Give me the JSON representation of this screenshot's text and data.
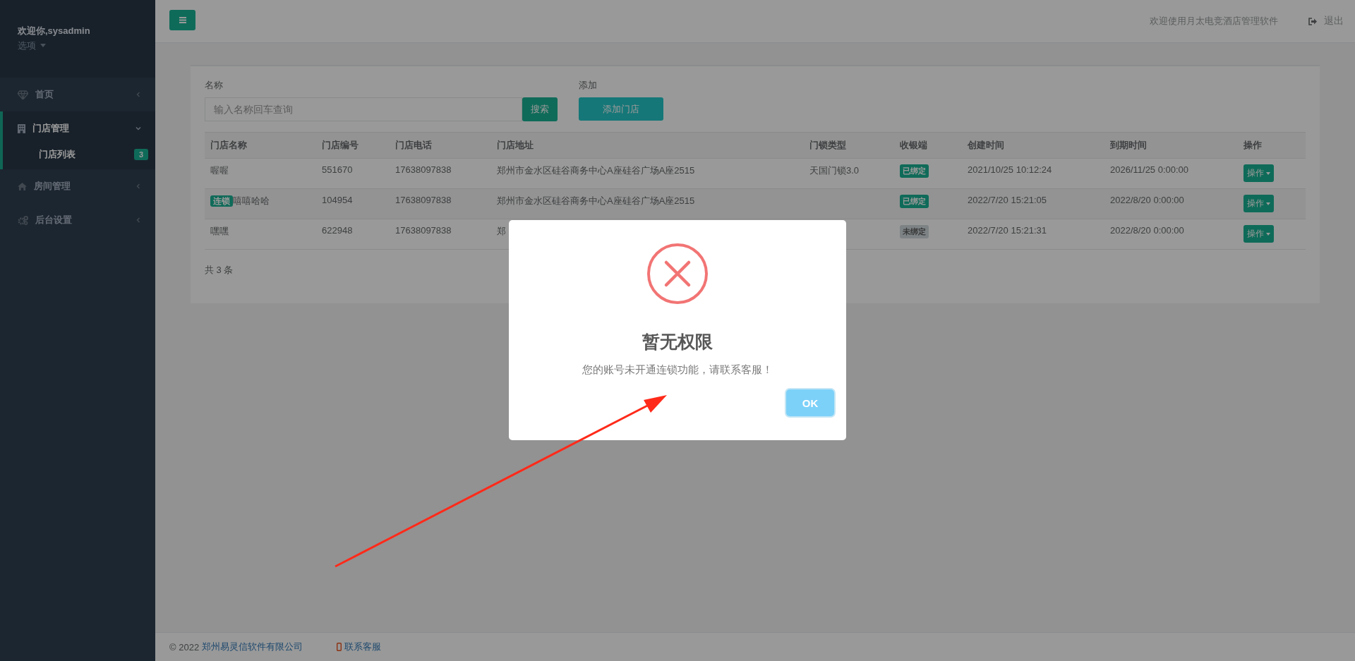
{
  "sidebar": {
    "user": "欢迎你,sysadmin",
    "options": "选项",
    "items": [
      {
        "label": "首页",
        "selected": false,
        "expanded": false
      },
      {
        "label": "门店管理",
        "selected": true,
        "expanded": true,
        "children": [
          {
            "label": "门店列表",
            "badge": "3",
            "selected": true
          }
        ]
      },
      {
        "label": "房间管理",
        "selected": false,
        "expanded": false
      },
      {
        "label": "后台设置",
        "selected": false,
        "expanded": false
      }
    ]
  },
  "header": {
    "welcome": "欢迎使用月太电竞酒店管理软件",
    "logout": "退出"
  },
  "search": {
    "label": "名称",
    "placeholder": "输入名称回车查询",
    "button": "搜索"
  },
  "add": {
    "label": "添加",
    "button": "添加门店"
  },
  "table": {
    "columns": [
      "门店名称",
      "门店编号",
      "门店电话",
      "门店地址",
      "门锁类型",
      "收银端",
      "创建时间",
      "到期时间",
      "操作"
    ],
    "rows": [
      {
        "tag": null,
        "name": "喔喔",
        "code": "551670",
        "phone": "17638097838",
        "address": "郑州市金水区硅谷商务中心A座硅谷广场A座2515",
        "lock": "天国门锁3.0",
        "bound": true,
        "cashier": "已绑定",
        "created": "2021/10/25 10:12:24",
        "expires": "2026/11/25 0:00:00",
        "action": "操作"
      },
      {
        "tag": "连锁",
        "name": "嘻嘻哈哈",
        "code": "104954",
        "phone": "17638097838",
        "address": "郑州市金水区硅谷商务中心A座硅谷广场A座2515",
        "lock": null,
        "bound": true,
        "cashier": "已绑定",
        "created": "2022/7/20 15:21:05",
        "expires": "2022/8/20 0:00:00",
        "action": "操作"
      },
      {
        "tag": null,
        "name": "嘿嘿",
        "code": "622948",
        "phone": "17638097838",
        "address": "郑",
        "lock": null,
        "bound": false,
        "cashier": "未绑定",
        "created": "2022/7/20 15:21:31",
        "expires": "2022/8/20 0:00:00",
        "action": "操作"
      }
    ],
    "total": "共 3 条"
  },
  "footer": {
    "copyright": "© 2022",
    "company": "郑州易灵信软件有限公司",
    "contact": "联系客服"
  },
  "dialog": {
    "title": "暂无权限",
    "message": "您的账号未开通连锁功能，请联系客服！",
    "button": "OK"
  }
}
